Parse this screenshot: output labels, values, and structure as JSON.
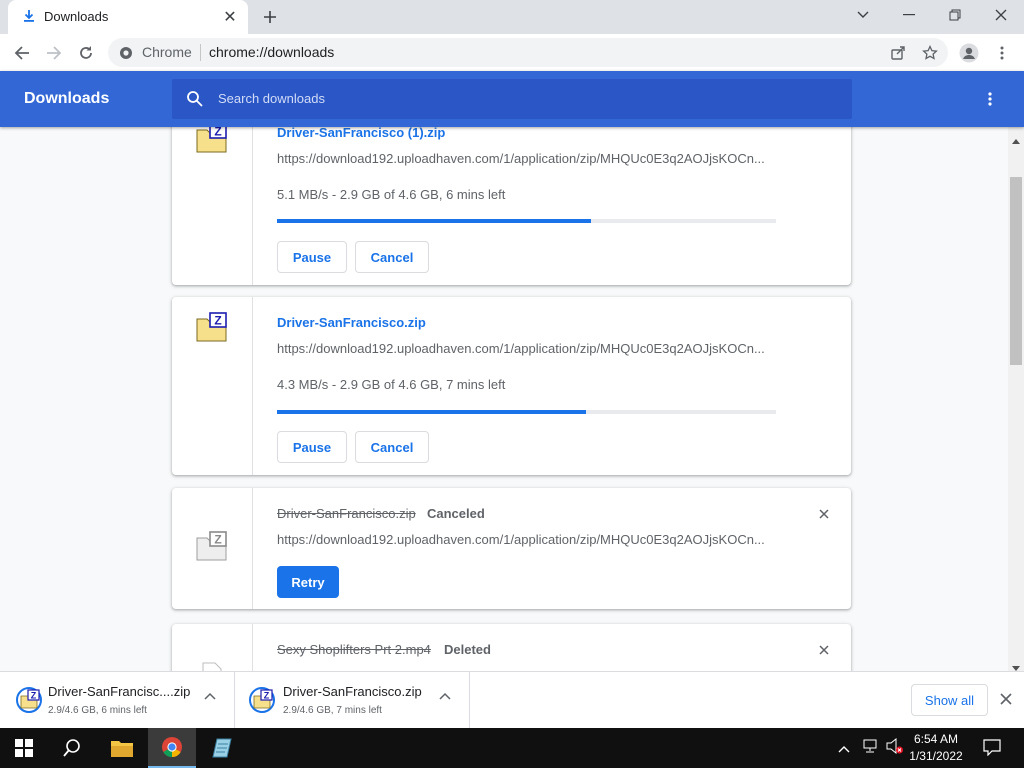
{
  "browser": {
    "tab_title": "Downloads",
    "omnibox_chip": "Chrome",
    "omnibox_url": "chrome://downloads"
  },
  "page": {
    "title": "Downloads",
    "search_placeholder": "Search downloads"
  },
  "downloads": [
    {
      "filename": "Driver-SanFrancisco (1).zip",
      "url": "https://download192.uploadhaven.com/1/application/zip/MHQUc0E3q2AOJjsKOCn...",
      "progress_text": "5.1 MB/s - 2.9 GB of 4.6 GB, 6 mins left",
      "progress": 0.63,
      "pause_label": "Pause",
      "cancel_label": "Cancel"
    },
    {
      "filename": "Driver-SanFrancisco.zip",
      "url": "https://download192.uploadhaven.com/1/application/zip/MHQUc0E3q2AOJjsKOCn...",
      "progress_text": "4.3 MB/s - 2.9 GB of 4.6 GB, 7 mins left",
      "progress": 0.62,
      "pause_label": "Pause",
      "cancel_label": "Cancel"
    },
    {
      "filename": "Driver-SanFrancisco.zip",
      "status": "Canceled",
      "url": "https://download192.uploadhaven.com/1/application/zip/MHQUc0E3q2AOJjsKOCn...",
      "retry_label": "Retry"
    },
    {
      "filename": "Sexy Shoplifters Prt 2.mp4",
      "status": "Deleted"
    }
  ],
  "shelf": {
    "items": [
      {
        "name": "Driver-SanFrancisc....zip",
        "status": "2.9/4.6 GB, 6 mins left"
      },
      {
        "name": "Driver-SanFrancisco.zip",
        "status": "2.9/4.6 GB, 7 mins left"
      }
    ],
    "show_all_label": "Show all"
  },
  "taskbar": {
    "time": "6:54 AM",
    "date": "1/31/2022"
  },
  "colors": {
    "header": "#3367d6",
    "accent": "#1a73e8",
    "taskbar": "#101010"
  }
}
